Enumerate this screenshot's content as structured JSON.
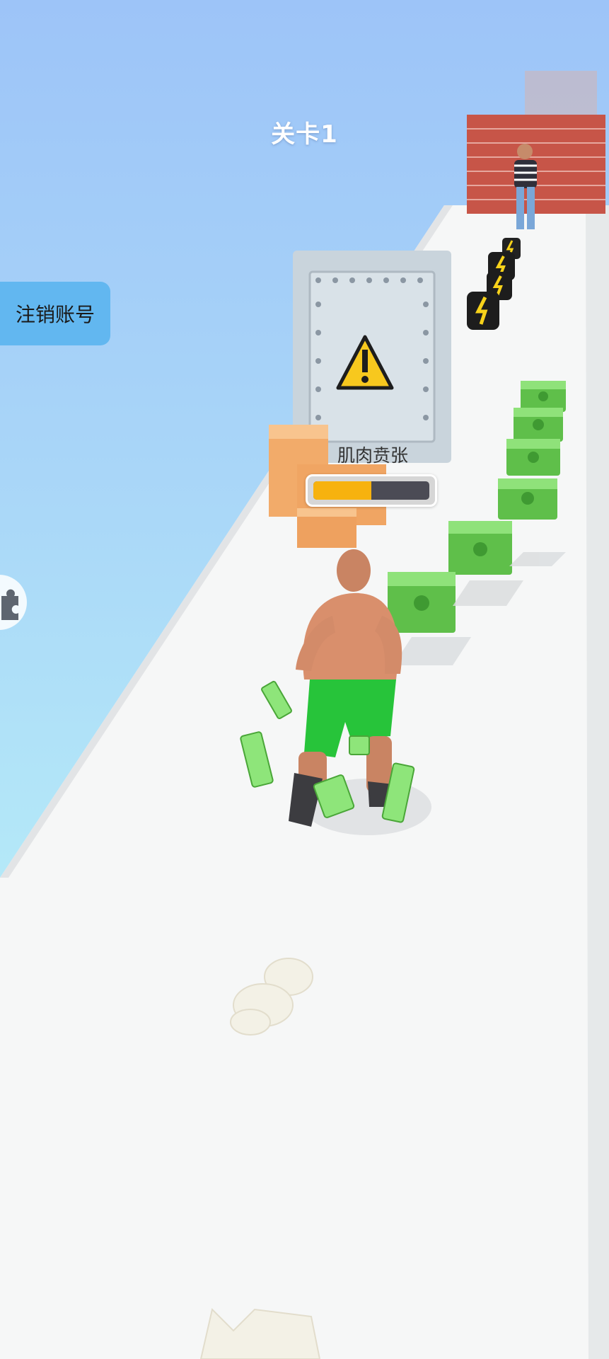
{
  "hud": {
    "level_label": "关卡1",
    "logout_button_label": "注销账号",
    "side_tool_icon": "puzzle-icon"
  },
  "player_status": {
    "label": "肌肉贲张",
    "progress": 0.5,
    "fill_color": "#f7b20e",
    "track_color": "#4b4b55"
  },
  "scene": {
    "hazard_sign_icon": "warning-icon",
    "item_types": [
      "money-stack",
      "energy-battery",
      "cardboard-box",
      "steel-door",
      "brick-wall"
    ]
  }
}
